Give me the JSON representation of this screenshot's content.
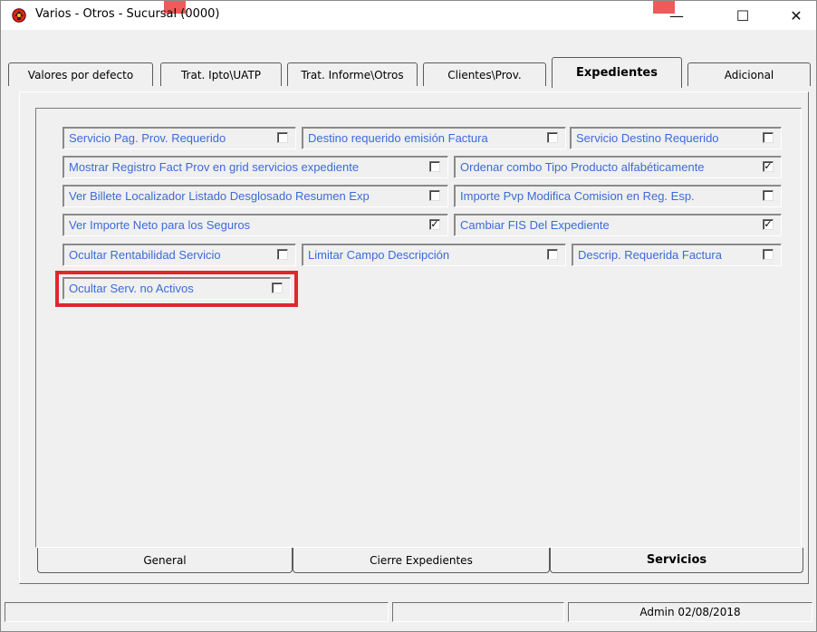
{
  "window": {
    "title": "Varios - Otros - Sucursal (0000)",
    "controls": {
      "minimize": "—",
      "maximize": "☐",
      "close": "✕"
    }
  },
  "tabs": [
    {
      "label": "Valores por defecto",
      "active": false
    },
    {
      "label": "Trat. Ipto\\UATP",
      "active": false
    },
    {
      "label": "Trat. Informe\\Otros",
      "active": false
    },
    {
      "label": "Clientes\\Prov.",
      "active": false
    },
    {
      "label": "Expedientes",
      "active": true
    },
    {
      "label": "Adicional",
      "active": false
    }
  ],
  "options": [
    {
      "label": "Servicio Pag. Prov. Requerido",
      "checked": false,
      "mark": ""
    },
    {
      "label": "Destino requerido emisión Factura",
      "checked": false,
      "mark": ""
    },
    {
      "label": "Servicio Destino Requerido",
      "checked": false,
      "mark": ""
    },
    {
      "label": "Mostrar Registro Fact Prov en grid servicios expediente",
      "checked": false,
      "mark": ""
    },
    {
      "label": "Ordenar combo Tipo Producto alfabéticamente",
      "checked": true,
      "mark": "✓"
    },
    {
      "label": "Ver Billete Localizador Listado Desglosado Resumen Exp",
      "checked": false,
      "mark": ""
    },
    {
      "label": "Importe Pvp Modifica Comision en Reg. Esp.",
      "checked": false,
      "mark": ""
    },
    {
      "label": "Ver Importe Neto para  los Seguros",
      "checked": true,
      "mark": "✓"
    },
    {
      "label": "Cambiar FIS Del Expediente",
      "checked": true,
      "mark": "✓"
    },
    {
      "label": "Ocultar Rentabilidad Servicio",
      "checked": false,
      "mark": ""
    },
    {
      "label": "Limitar Campo Descripción",
      "checked": false,
      "mark": ""
    },
    {
      "label": "Descrip. Requerida Factura",
      "checked": false,
      "mark": ""
    },
    {
      "label": "Ocultar Serv. no Activos",
      "checked": false,
      "mark": ""
    }
  ],
  "bottom_tabs": [
    {
      "label": "General",
      "active": false
    },
    {
      "label": "Cierre Expedientes",
      "active": false
    },
    {
      "label": "Servicios",
      "active": true
    }
  ],
  "status": {
    "user_date": "Admin 02/08/2018"
  },
  "colors": {
    "option_text": "#3b6bd8",
    "highlight": "#e2262d"
  },
  "icons": {
    "app": "app-logo-icon"
  }
}
